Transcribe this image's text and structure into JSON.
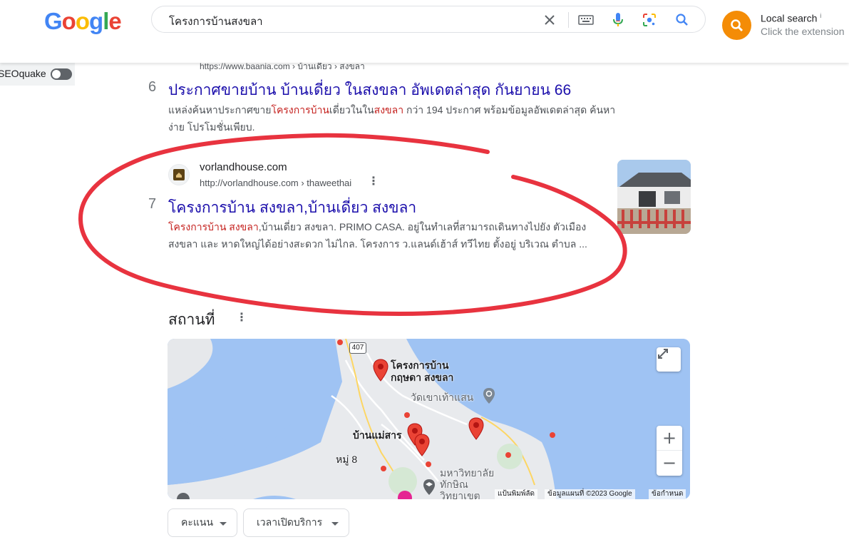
{
  "header": {
    "logo": [
      "G",
      "o",
      "o",
      "g",
      "l",
      "e"
    ],
    "logo_colors": [
      "#4285f4",
      "#ea4335",
      "#fbbc05",
      "#4285f4",
      "#34a853",
      "#ea4335"
    ],
    "query": "โครงการบ้านสงขลา",
    "local_search_title": "Local search",
    "local_search_info": "i",
    "local_search_sub": "Click the extension"
  },
  "seoquake": {
    "label": "SEOquake"
  },
  "results": {
    "r6": {
      "url": "https://www.baania.com › บ้านเดี่ยว › สงขลา",
      "number": "6",
      "title": "ประกาศขายบ้าน บ้านเดี่ยว ในสงขลา อัพเดตล่าสุด กันยายน 66",
      "snippet_a": "แหล่งค้นหาประกาศขาย",
      "snippet_em1": "โครงการบ้าน",
      "snippet_b": "เดี่ยวในใน",
      "snippet_em2": "สงขลา",
      "snippet_c": " กว่า 194 ประกาศ พร้อมข้อมูลอัพเดตล่าสุด ค้นหาง่าย โปรโมชั่นเพียบ."
    },
    "r7": {
      "site": "vorlandhouse.com",
      "crumb": "http://vorlandhouse.com › thaweethai",
      "number": "7",
      "title": "โครงการบ้าน สงขลา,บ้านเดี่ยว สงขลา",
      "snippet_em": "โครงการบ้าน สงขลา",
      "snippet_rest": ",บ้านเดี่ยว สงขลา. PRIMO CASA. อยู่ในทำเลที่สามารถเดินทางไปยัง ตัวเมืองสงขลา และ หาดใหญ่ได้อย่างสะดวก ไม่ไกล. โครงการ ว.แลนด์เฮ้าส์ ทวีไทย ตั้งอยู่ บริเวณ ตำบล ..."
    }
  },
  "places": {
    "heading": "สถานที่",
    "map": {
      "road_shield": "407",
      "label_project_1": "โครงการบ้าน",
      "label_project_2": "กฤษดา สงขลา",
      "label_temple": "วัดเขาเท้าแสน",
      "label_village": "บ้านแม่สาร",
      "label_moo": "หมู่ 8",
      "label_uni_1": "มหาวิทยาลัย",
      "label_uni_2": "ทักษิณ",
      "label_uni_3": "วิทยาเขต",
      "zoom_in": "+",
      "zoom_out": "−",
      "attrib_shortcuts": "แป้นพิมพ์ลัด",
      "attrib_data": "ข้อมูลแผนที่ ©2023 Google",
      "attrib_terms": "ข้อกำหนด"
    },
    "chips": [
      "คะแนน",
      "เวลาเปิดบริการ"
    ]
  },
  "colors": {
    "link": "#1a0dab",
    "highlight": "#c5221f",
    "annotation": "#e8333f",
    "pin": "#ea4335",
    "extension": "#f48c06"
  }
}
